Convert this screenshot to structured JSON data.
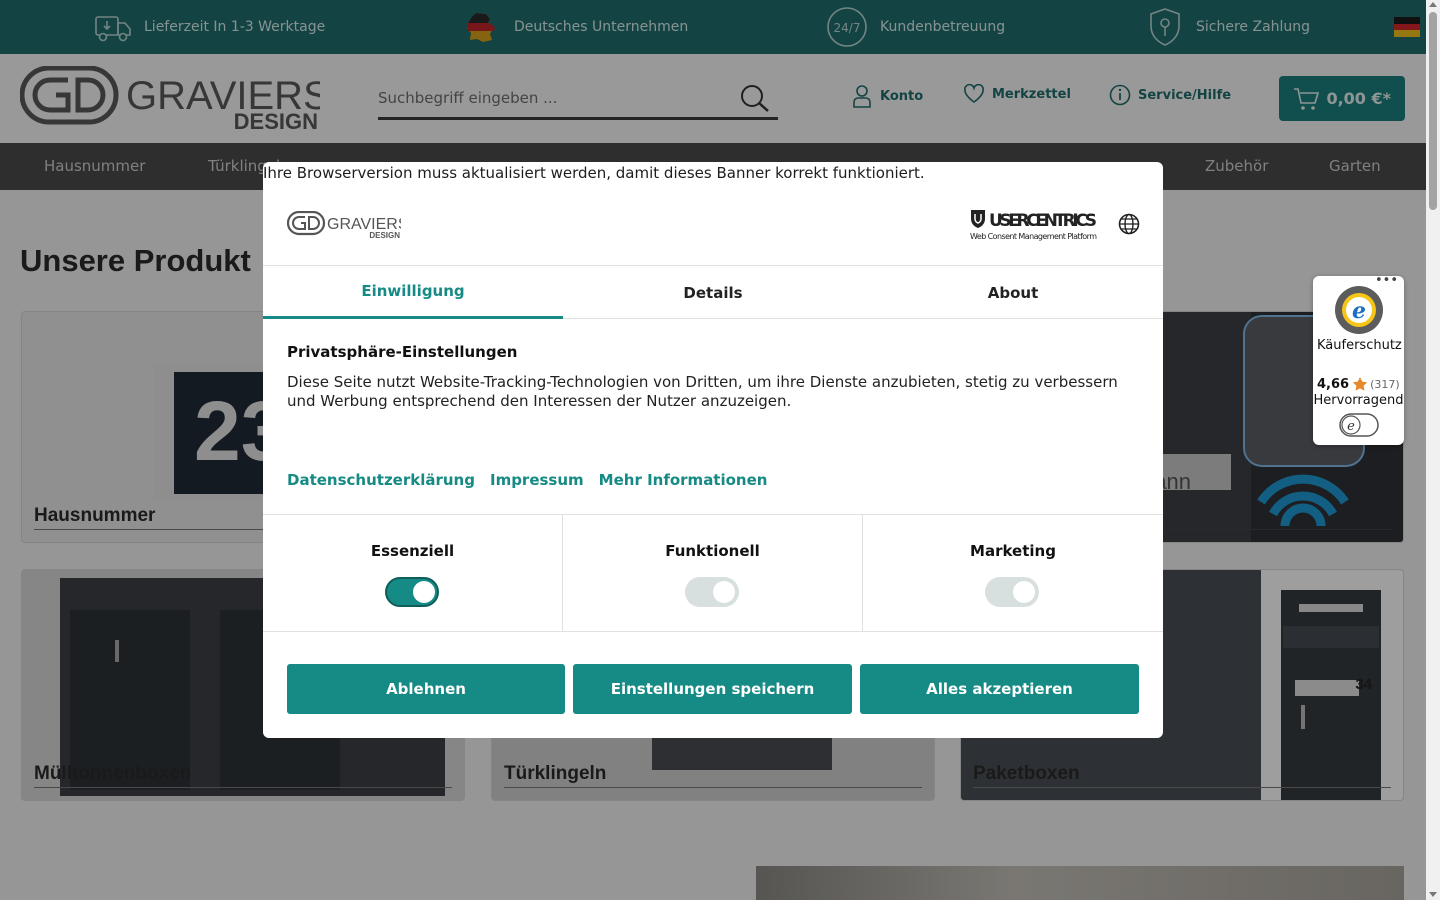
{
  "topbar": {
    "usps": [
      {
        "label": "Lieferzeit In 1-3 Werktage",
        "icon": "delivery-truck-icon"
      },
      {
        "label": "Deutsches Unternehmen",
        "icon": "germany-map-icon"
      },
      {
        "label": "Kundenbetreuung",
        "icon": "24-7-support-icon"
      },
      {
        "label": "Sichere Zahlung",
        "icon": "secure-shield-icon"
      }
    ],
    "support_icon_text": "24/7",
    "language_flag": "germany-flag-icon"
  },
  "header": {
    "logo_text": "GRAVIERS",
    "logo_subtext": "DESIGN",
    "search": {
      "placeholder": "Suchbegriff eingeben ..."
    },
    "links": {
      "account": "Konto",
      "wishlist": "Merkzettel",
      "service": "Service/Hilfe"
    },
    "cart_total": "0,00 €*"
  },
  "nav": {
    "items": [
      "Hausnummer",
      "Türklingeln",
      "Zubehör",
      "Garten"
    ]
  },
  "main": {
    "heading": "Unsere Produkt",
    "tiles": [
      {
        "label": "Hausnummer"
      },
      {
        "label": "Mülltonnenboxen"
      },
      {
        "label": "Türklingeln"
      },
      {
        "label": "Paketboxen"
      }
    ],
    "house_number_sample": "23",
    "doorbell_name_sample": "mann",
    "parcel_box_number_sample": "34"
  },
  "trusted_shops": {
    "menu": "•••",
    "label": "Käuferschutz",
    "score": "4,66",
    "count": "(317)",
    "grade": "Hervorragend"
  },
  "consent": {
    "browser_warning": "Ihre Browserversion muss aktualisiert werden, damit dieses Banner korrekt funktioniert.",
    "brand_logo": "GRAVIERS",
    "brand_logo_sub": "DESIGN",
    "provider": "USERCENTRICS",
    "provider_sub": "Web Consent Management Platform",
    "tabs": [
      "Einwilligung",
      "Details",
      "About"
    ],
    "active_tab": "Einwilligung",
    "title": "Privatsphäre-Einstellungen",
    "description": "Diese Seite nutzt Website-Tracking-Technologien von Dritten, um ihre Dienste anzubieten, stetig zu verbessern und Werbung entsprechend den Interessen der Nutzer anzuzeigen.",
    "links": [
      "Datenschutzerklärung",
      "Impressum",
      "Mehr Informationen"
    ],
    "categories": [
      {
        "label": "Essenziell",
        "enabled": true
      },
      {
        "label": "Funktionell",
        "enabled": false
      },
      {
        "label": "Marketing",
        "enabled": false
      }
    ],
    "buttons": {
      "deny": "Ablehnen",
      "save": "Einstellungen speichern",
      "accept_all": "Alles akzeptieren"
    }
  },
  "colors": {
    "brand_teal": "#1a807c",
    "topbar": "#1f6f6d",
    "nav": "#4b4b4b",
    "accent": "#168a84"
  }
}
